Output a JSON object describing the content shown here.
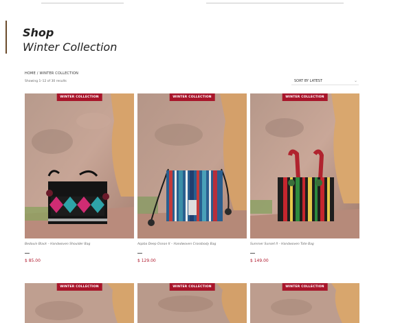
{
  "page": {
    "shop_title": "Shop",
    "collection_title": "Winter Collection"
  },
  "breadcrumb": {
    "home": "HOME",
    "separator": " / ",
    "current": "WINTER COLLECTION"
  },
  "results": {
    "text": "Showing 1–12 of 30 results"
  },
  "sort": {
    "selected": "SORT BY LATEST"
  },
  "colors": {
    "badge": "#a8152a",
    "price": "#b01a2e"
  },
  "products": [
    {
      "badge": "WINTER COLLECTION",
      "name": "Bedouin Black – Handwoven Shoulder Bag",
      "price": "$ 85.00"
    },
    {
      "badge": "WINTER COLLECTION",
      "name": "Aqaba Deep Ocean II – Handwoven Crossbody Bag",
      "price": "$ 129.00"
    },
    {
      "badge": "WINTER COLLECTION",
      "name": "Summer Sunset II – Handwoven Tote Bag",
      "price": "$ 149.00"
    },
    {
      "badge": "WINTER COLLECTION"
    },
    {
      "badge": "WINTER COLLECTION"
    },
    {
      "badge": "WINTER COLLECTION"
    }
  ]
}
